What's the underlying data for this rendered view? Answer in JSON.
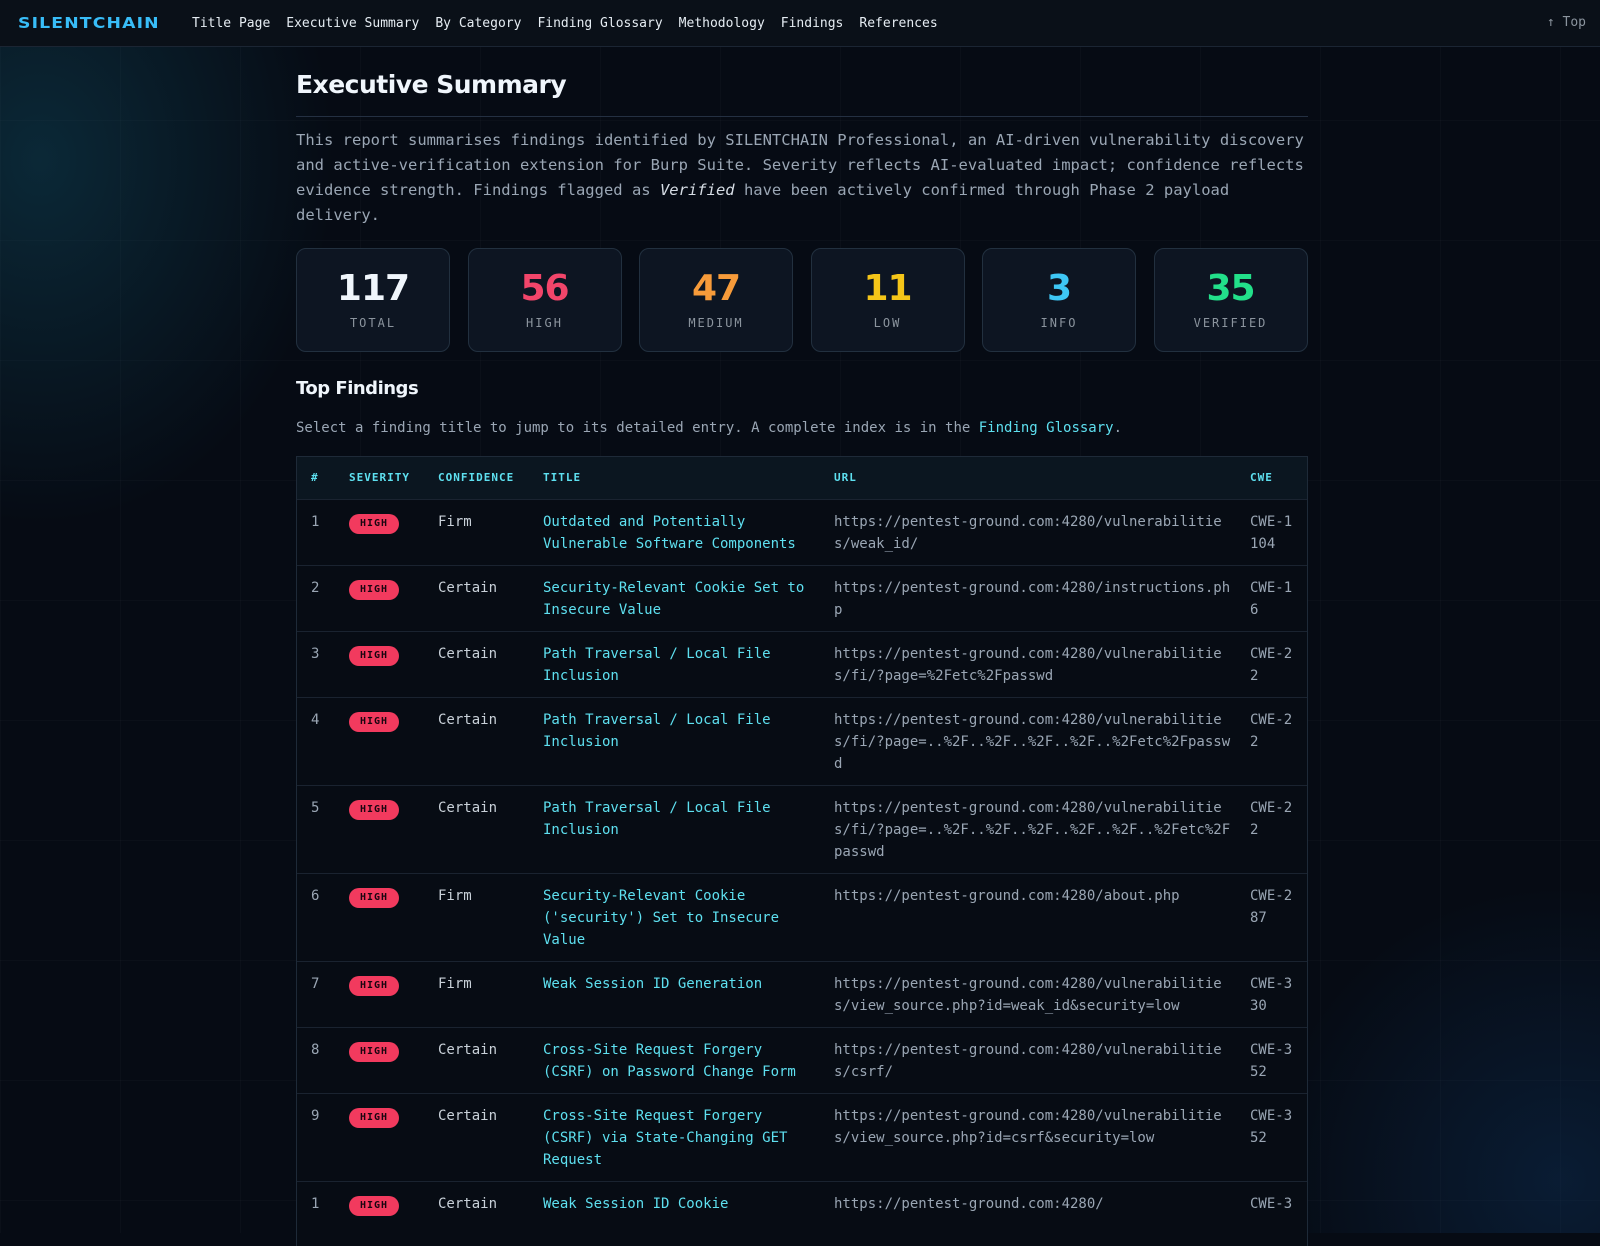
{
  "nav": {
    "brand": "SILENTCHAIN",
    "links": [
      "Title Page",
      "Executive Summary",
      "By Category",
      "Finding Glossary",
      "Methodology",
      "Findings",
      "References"
    ],
    "top_label": "↑ Top"
  },
  "page": {
    "title": "Executive Summary",
    "intro_before": "This report summarises findings identified by SILENTCHAIN Professional, an AI-driven vulnerability discovery and active-verification extension for Burp Suite. Severity reflects AI-evaluated impact; confidence reflects evidence strength. Findings flagged as ",
    "intro_em": "Verified",
    "intro_after": " have been actively confirmed through Phase 2 payload delivery."
  },
  "stats": [
    {
      "value": "117",
      "label": "TOTAL",
      "color": "#f0f6fc"
    },
    {
      "value": "56",
      "label": "HIGH",
      "color": "#f2456a"
    },
    {
      "value": "47",
      "label": "MEDIUM",
      "color": "#f79b3a"
    },
    {
      "value": "11",
      "label": "LOW",
      "color": "#f5c518"
    },
    {
      "value": "3",
      "label": "INFO",
      "color": "#3ec7f5"
    },
    {
      "value": "35",
      "label": "VERIFIED",
      "color": "#22e08a"
    }
  ],
  "top_findings": {
    "heading": "Top Findings",
    "intro_before": "Select a finding title to jump to its detailed entry. A complete index is in the ",
    "intro_link": "Finding Glossary",
    "intro_after": ".",
    "columns": [
      "#",
      "SEVERITY",
      "CONFIDENCE",
      "TITLE",
      "URL",
      "CWE"
    ],
    "rows": [
      {
        "n": "1",
        "severity": "HIGH",
        "confidence": "Firm",
        "title": "Outdated and Potentially Vulnerable Software Components",
        "url": "https://pentest-ground.com:4280/vulnerabilities/weak_id/",
        "cwe": "CWE-1104"
      },
      {
        "n": "2",
        "severity": "HIGH",
        "confidence": "Certain",
        "title": "Security-Relevant Cookie Set to Insecure Value",
        "url": "https://pentest-ground.com:4280/instructions.php",
        "cwe": "CWE-16"
      },
      {
        "n": "3",
        "severity": "HIGH",
        "confidence": "Certain",
        "title": "Path Traversal / Local File Inclusion",
        "url": "https://pentest-ground.com:4280/vulnerabilities/fi/?page=%2Fetc%2Fpasswd",
        "cwe": "CWE-22"
      },
      {
        "n": "4",
        "severity": "HIGH",
        "confidence": "Certain",
        "title": "Path Traversal / Local File Inclusion",
        "url": "https://pentest-ground.com:4280/vulnerabilities/fi/?page=..%2F..%2F..%2F..%2F..%2Fetc%2Fpasswd",
        "cwe": "CWE-22"
      },
      {
        "n": "5",
        "severity": "HIGH",
        "confidence": "Certain",
        "title": "Path Traversal / Local File Inclusion",
        "url": "https://pentest-ground.com:4280/vulnerabilities/fi/?page=..%2F..%2F..%2F..%2F..%2F..%2Fetc%2Fpasswd",
        "cwe": "CWE-22"
      },
      {
        "n": "6",
        "severity": "HIGH",
        "confidence": "Firm",
        "title": "Security-Relevant Cookie ('security') Set to Insecure Value",
        "url": "https://pentest-ground.com:4280/about.php",
        "cwe": "CWE-287"
      },
      {
        "n": "7",
        "severity": "HIGH",
        "confidence": "Firm",
        "title": "Weak Session ID Generation",
        "url": "https://pentest-ground.com:4280/vulnerabilities/view_source.php?id=weak_id&security=low",
        "cwe": "CWE-330"
      },
      {
        "n": "8",
        "severity": "HIGH",
        "confidence": "Certain",
        "title": "Cross-Site Request Forgery (CSRF) on Password Change Form",
        "url": "https://pentest-ground.com:4280/vulnerabilities/csrf/",
        "cwe": "CWE-352"
      },
      {
        "n": "9",
        "severity": "HIGH",
        "confidence": "Certain",
        "title": "Cross-Site Request Forgery (CSRF) via State-Changing GET Request",
        "url": "https://pentest-ground.com:4280/vulnerabilities/view_source.php?id=csrf&security=low",
        "cwe": "CWE-352"
      },
      {
        "n": "1",
        "severity": "HIGH",
        "confidence": "Certain",
        "title": "Weak Session ID Cookie",
        "url": "https://pentest-ground.com:4280/",
        "cwe": "CWE-3"
      }
    ]
  }
}
